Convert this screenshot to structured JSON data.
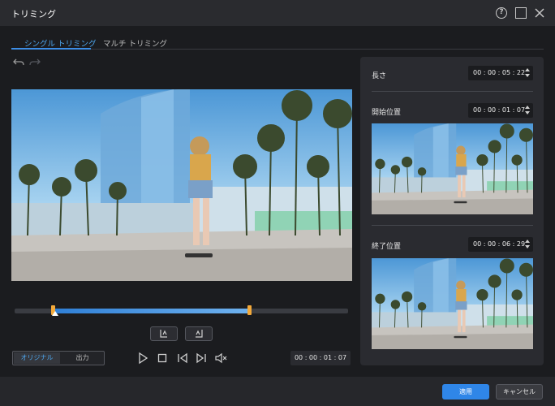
{
  "window": {
    "title": "トリミング",
    "help_glyph": "?"
  },
  "tabs": {
    "single": "シングル トリミング",
    "multi": "マルチ トリミング"
  },
  "playback": {
    "mode_original": "オリジナル",
    "mode_output": "出力",
    "current_time": "00 : 00 : 01 : 07"
  },
  "panel": {
    "length_label": "長さ",
    "length_value": "00 : 00 : 05 : 22",
    "start_label": "開始位置",
    "start_value": "00 : 00 : 01 : 07",
    "end_label": "終了位置",
    "end_value": "00 : 00 : 06 : 29"
  },
  "footer": {
    "apply": "適用",
    "cancel": "キャンセル"
  },
  "colors": {
    "accent": "#2f86e8",
    "handle": "#f2a93b",
    "background": "#1b1c1f"
  },
  "icons": [
    "help-icon",
    "maximize-icon",
    "close-icon",
    "undo-icon",
    "redo-icon",
    "mark-in-icon",
    "mark-out-icon",
    "play-icon",
    "stop-icon",
    "prev-frame-icon",
    "next-frame-icon",
    "mute-icon"
  ]
}
